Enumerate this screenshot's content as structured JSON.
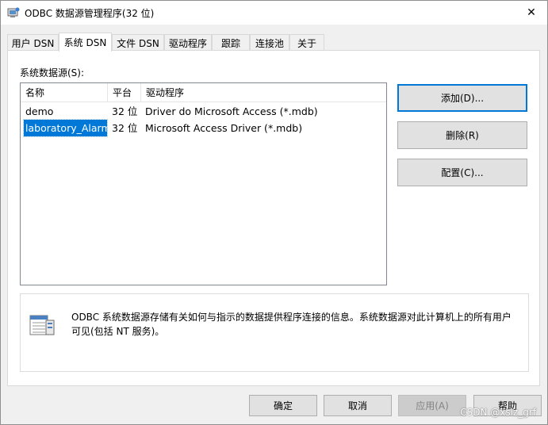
{
  "window": {
    "title": "ODBC 数据源管理程序(32 位)",
    "close_glyph": "✕"
  },
  "tabs": [
    {
      "label": "用户 DSN"
    },
    {
      "label": "系统 DSN"
    },
    {
      "label": "文件 DSN"
    },
    {
      "label": "驱动程序"
    },
    {
      "label": "跟踪"
    },
    {
      "label": "连接池"
    },
    {
      "label": "关于"
    }
  ],
  "active_tab": "系统 DSN",
  "system_dsn": {
    "group_label": "系统数据源(S):",
    "columns": [
      "名称",
      "平台",
      "驱动程序"
    ],
    "rows": [
      {
        "name": "demo",
        "platform": "32 位",
        "driver": "Driver do Microsoft Access (*.mdb)",
        "selected": false
      },
      {
        "name": "laboratory_Alarm",
        "platform": "32 位",
        "driver": "Microsoft Access Driver (*.mdb)",
        "selected": true
      }
    ],
    "buttons": {
      "add": "添加(D)...",
      "remove": "删除(R)",
      "configure": "配置(C)..."
    },
    "info_text": "ODBC 系统数据源存储有关如何与指示的数据提供程序连接的信息。系统数据源对此计算机上的所有用户可见(包括 NT 服务)。"
  },
  "footer": {
    "ok": "确定",
    "cancel": "取消",
    "apply": "应用(A)",
    "help": "帮助"
  },
  "watermark": "CSDN @xslz_grf",
  "colors": {
    "selection": "#0078d7",
    "button_bg": "#e1e1e1",
    "window_bg": "#f0f0f0"
  }
}
